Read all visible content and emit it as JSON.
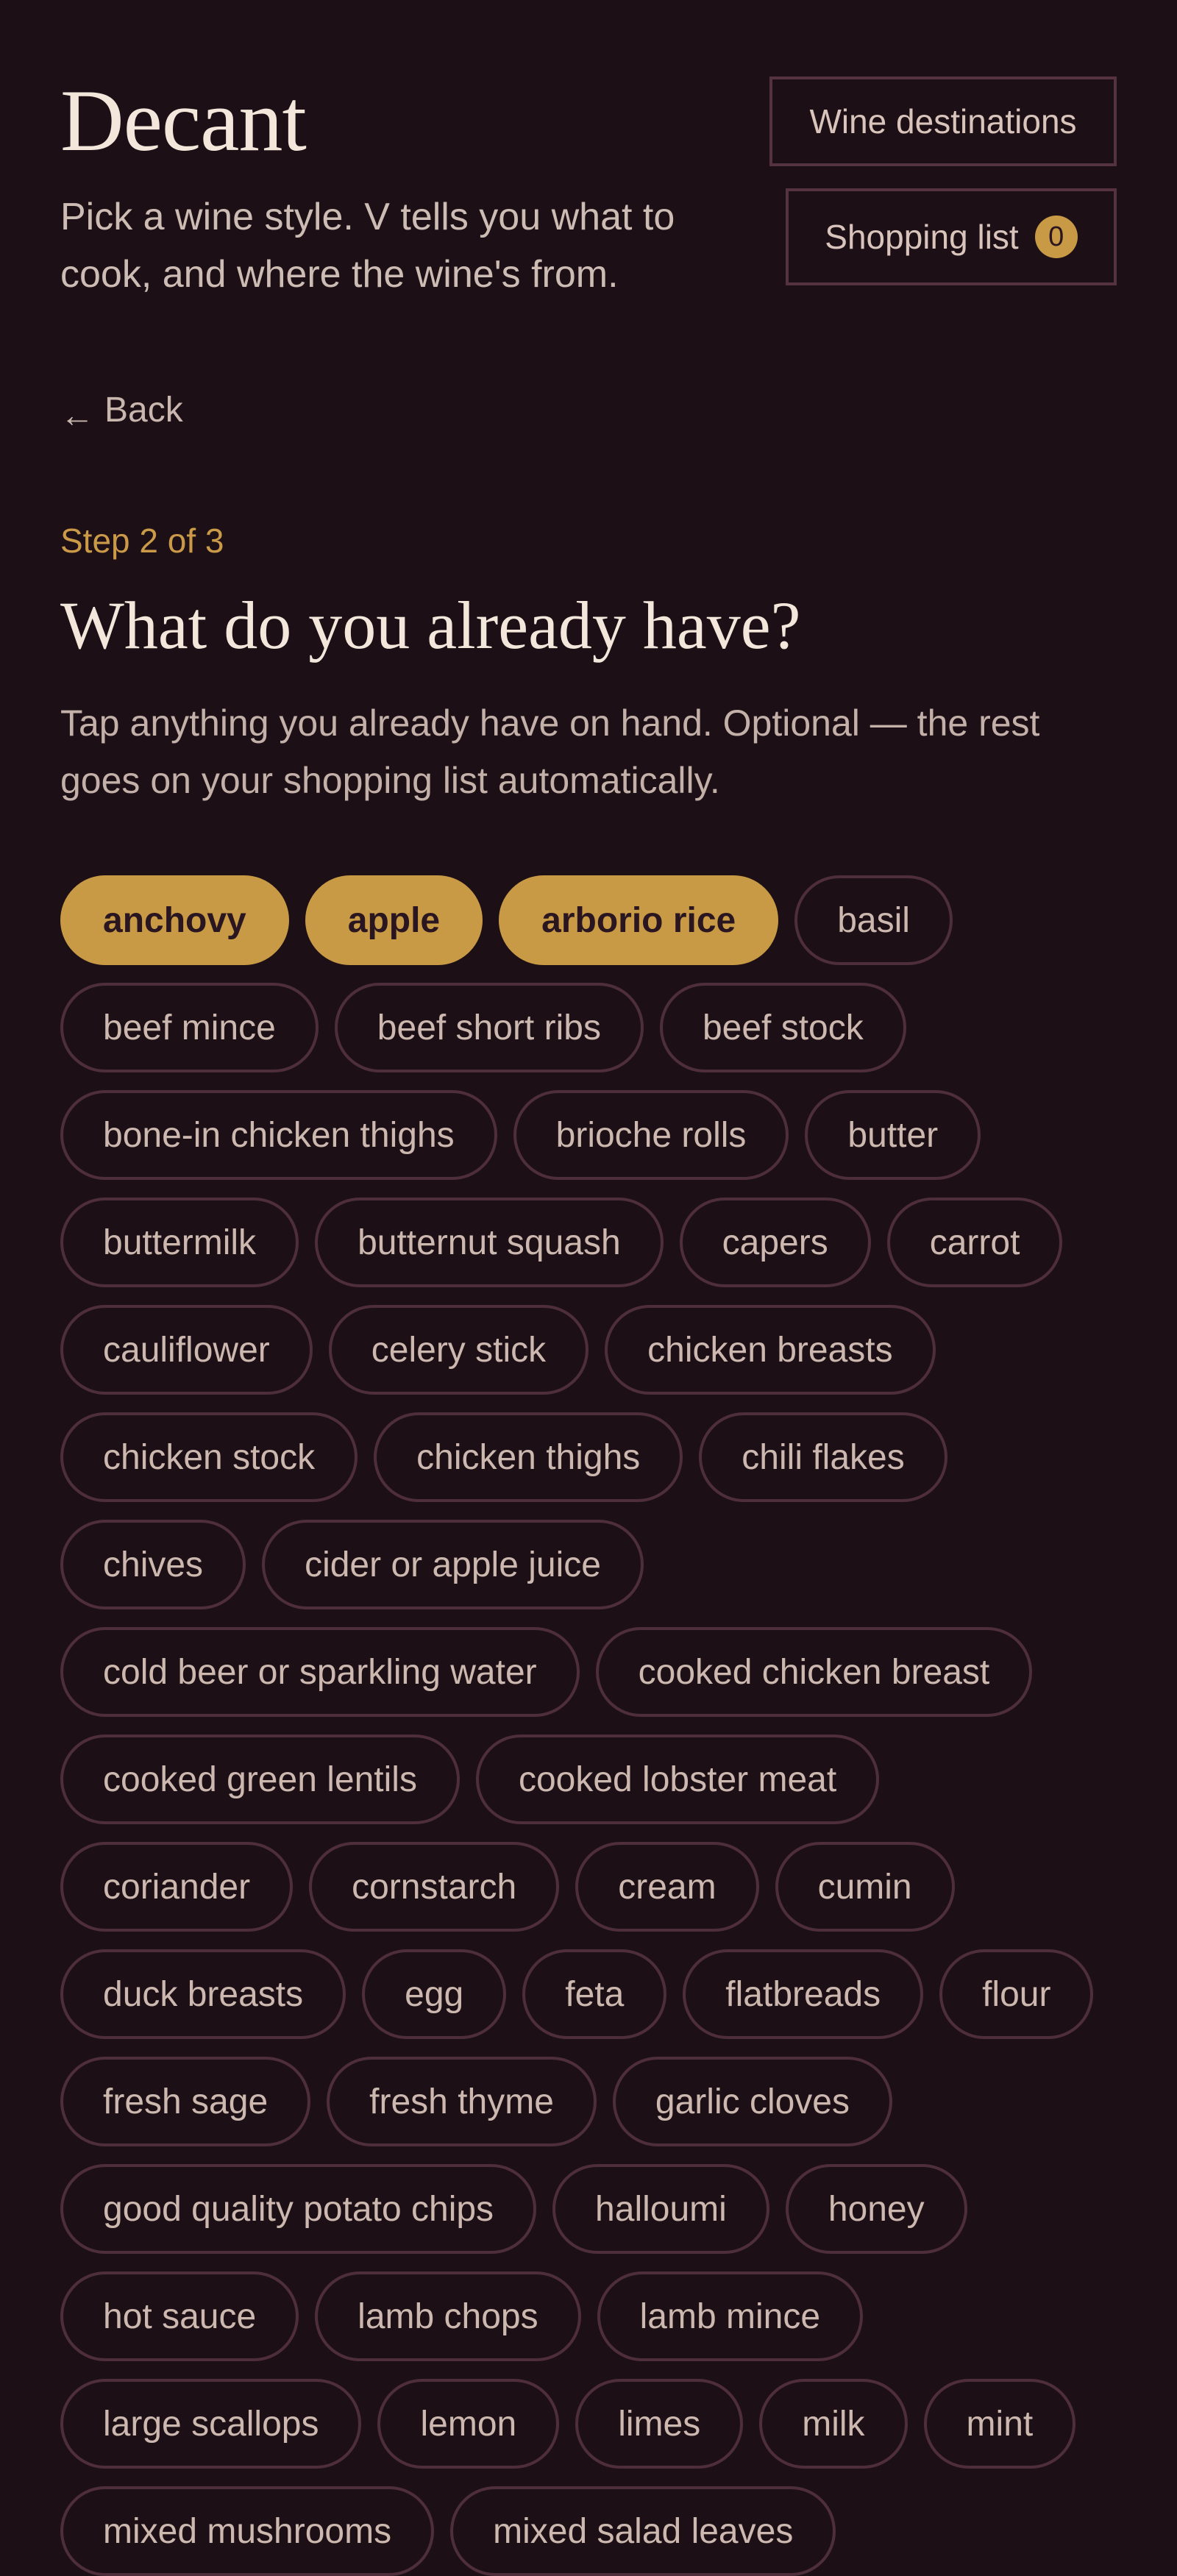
{
  "header": {
    "brand": "Decant",
    "tagline": "Pick a wine style. V tells you what to cook, and where the wine's from.",
    "wine_destinations_label": "Wine destinations",
    "shopping_list_label": "Shopping list",
    "shopping_list_count": "0"
  },
  "nav": {
    "back_arrow": "←",
    "back_label": "Back"
  },
  "step": {
    "label": "Step 2 of 3",
    "question": "What do you already have?",
    "helper": "Tap anything you already have on hand. Optional — the rest goes on your shopping list automatically."
  },
  "ingredients": [
    {
      "label": "anchovy",
      "selected": true
    },
    {
      "label": "apple",
      "selected": true
    },
    {
      "label": "arborio rice",
      "selected": true
    },
    {
      "label": "basil",
      "selected": false
    },
    {
      "label": "beef mince",
      "selected": false
    },
    {
      "label": "beef short ribs",
      "selected": false
    },
    {
      "label": "beef stock",
      "selected": false
    },
    {
      "label": "bone-in chicken thighs",
      "selected": false
    },
    {
      "label": "brioche rolls",
      "selected": false
    },
    {
      "label": "butter",
      "selected": false
    },
    {
      "label": "buttermilk",
      "selected": false
    },
    {
      "label": "butternut squash",
      "selected": false
    },
    {
      "label": "capers",
      "selected": false
    },
    {
      "label": "carrot",
      "selected": false
    },
    {
      "label": "cauliflower",
      "selected": false
    },
    {
      "label": "celery stick",
      "selected": false
    },
    {
      "label": "chicken breasts",
      "selected": false
    },
    {
      "label": "chicken stock",
      "selected": false
    },
    {
      "label": "chicken thighs",
      "selected": false
    },
    {
      "label": "chili flakes",
      "selected": false
    },
    {
      "label": "chives",
      "selected": false
    },
    {
      "label": "cider or apple juice",
      "selected": false
    },
    {
      "label": "cold beer or sparkling water",
      "selected": false
    },
    {
      "label": "cooked chicken breast",
      "selected": false
    },
    {
      "label": "cooked green lentils",
      "selected": false
    },
    {
      "label": "cooked lobster meat",
      "selected": false
    },
    {
      "label": "coriander",
      "selected": false
    },
    {
      "label": "cornstarch",
      "selected": false
    },
    {
      "label": "cream",
      "selected": false
    },
    {
      "label": "cumin",
      "selected": false
    },
    {
      "label": "duck breasts",
      "selected": false
    },
    {
      "label": "egg",
      "selected": false
    },
    {
      "label": "feta",
      "selected": false
    },
    {
      "label": "flatbreads",
      "selected": false
    },
    {
      "label": "flour",
      "selected": false
    },
    {
      "label": "fresh sage",
      "selected": false
    },
    {
      "label": "fresh thyme",
      "selected": false
    },
    {
      "label": "garlic cloves",
      "selected": false
    },
    {
      "label": "good quality potato chips",
      "selected": false
    },
    {
      "label": "halloumi",
      "selected": false
    },
    {
      "label": "honey",
      "selected": false
    },
    {
      "label": "hot sauce",
      "selected": false
    },
    {
      "label": "lamb chops",
      "selected": false
    },
    {
      "label": "lamb mince",
      "selected": false
    },
    {
      "label": "large scallops",
      "selected": false
    },
    {
      "label": "lemon",
      "selected": false
    },
    {
      "label": "limes",
      "selected": false
    },
    {
      "label": "milk",
      "selected": false
    },
    {
      "label": "mint",
      "selected": false
    },
    {
      "label": "mixed mushrooms",
      "selected": false
    },
    {
      "label": "mixed salad leaves",
      "selected": false
    }
  ],
  "colors": {
    "background": "#1c1016",
    "accent": "#c99a45",
    "chip_border": "#4e2e3a",
    "step_label": "#cb9a48"
  }
}
